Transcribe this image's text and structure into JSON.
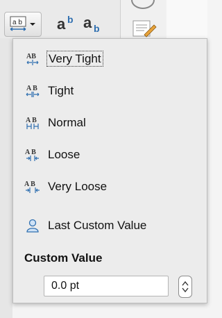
{
  "toolbar": {
    "spacing_button_icon": "char-spacing-icon",
    "dropdown_arrow": "▾",
    "icons": [
      "superscript-ab-icon",
      "subscript-ab-icon",
      "edit-document-icon"
    ]
  },
  "menu": {
    "items": [
      {
        "label": "Very Tight",
        "icon": "spacing-very-tight-icon"
      },
      {
        "label": "Tight",
        "icon": "spacing-tight-icon"
      },
      {
        "label": "Normal",
        "icon": "spacing-normal-icon"
      },
      {
        "label": "Loose",
        "icon": "spacing-loose-icon"
      },
      {
        "label": "Very Loose",
        "icon": "spacing-very-loose-icon"
      },
      {
        "label": "Last Custom Value",
        "icon": "user-icon"
      }
    ],
    "custom_title": "Custom Value",
    "custom_value": "0.0 pt"
  },
  "colors": {
    "icon_blue": "#2f6fb0",
    "panel": "#ececec"
  }
}
